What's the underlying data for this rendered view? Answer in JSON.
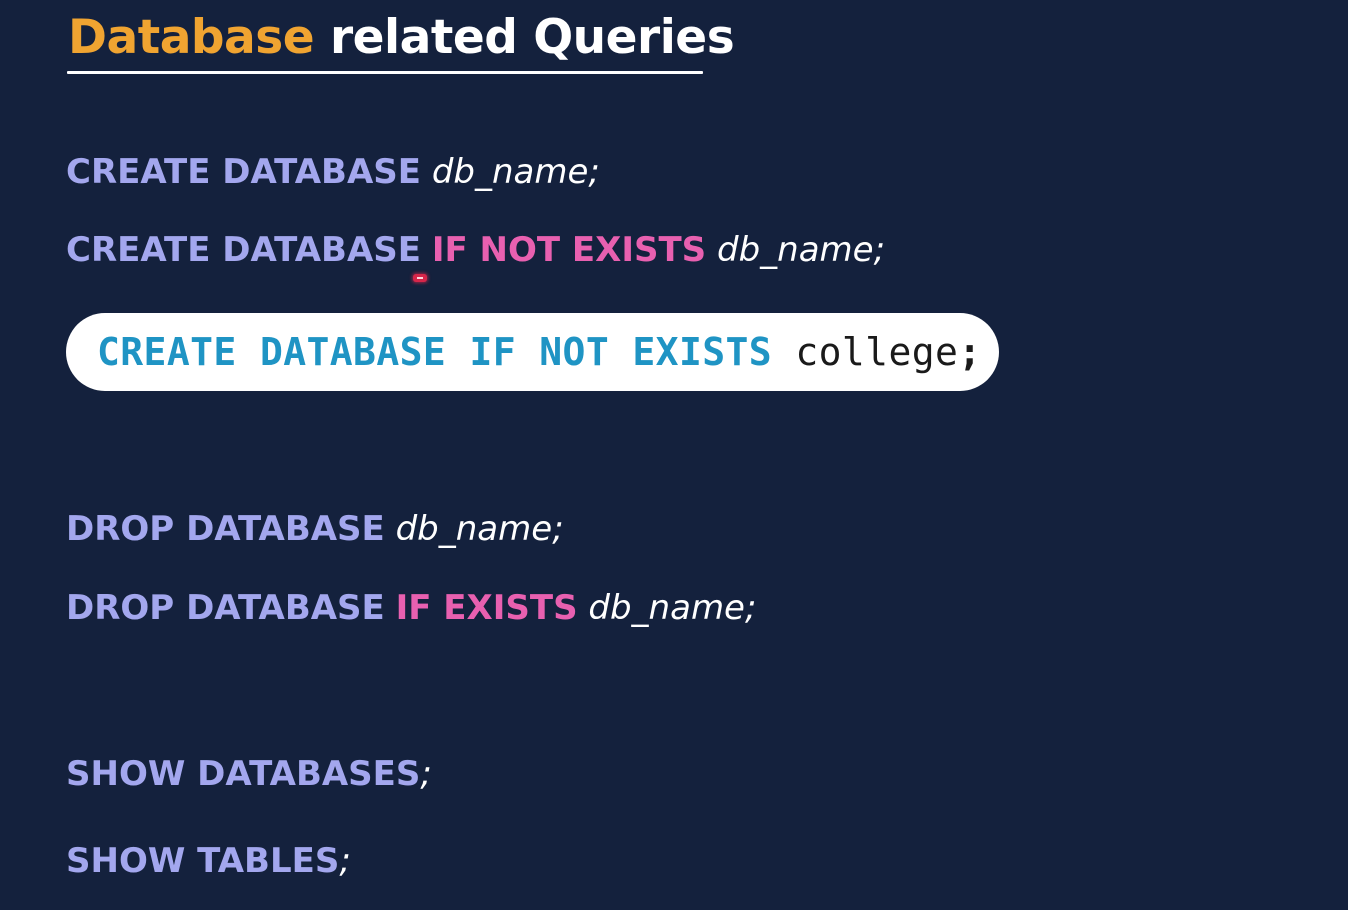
{
  "title": {
    "accent": "Database",
    "rest": "related Queries"
  },
  "queries": {
    "create_db": {
      "keyword": "CREATE DATABASE",
      "identifier": "db_name",
      "semicolon": ";"
    },
    "create_db_if_not_exists": {
      "keyword": "CREATE DATABASE",
      "condition": "IF NOT EXISTS",
      "identifier": "db_name",
      "semicolon": ";"
    },
    "drop_db": {
      "keyword": "DROP DATABASE",
      "identifier": "db_name",
      "semicolon": ";"
    },
    "drop_db_if_exists": {
      "keyword": "DROP DATABASE",
      "condition": "IF EXISTS",
      "identifier": "db_name",
      "semicolon": ";"
    },
    "show_databases": {
      "keyword": "SHOW DATABASES",
      "semicolon": ";"
    },
    "show_tables": {
      "keyword": "SHOW TABLES",
      "semicolon": ";"
    }
  },
  "example": {
    "keyword": "CREATE DATABASE IF NOT EXISTS",
    "identifier": "college",
    "semicolon": ";"
  },
  "colors": {
    "background": "#14213d",
    "title_accent": "#f0a431",
    "title_text": "#ffffff",
    "keyword": "#a3a7ee",
    "condition_keyword": "#e860b0",
    "code_keyword": "#1f94c4",
    "code_box": "#ffffff",
    "cursor_marker": "#d6264a"
  },
  "icons": {
    "cursor_marker": "cursor-indicator-icon"
  }
}
